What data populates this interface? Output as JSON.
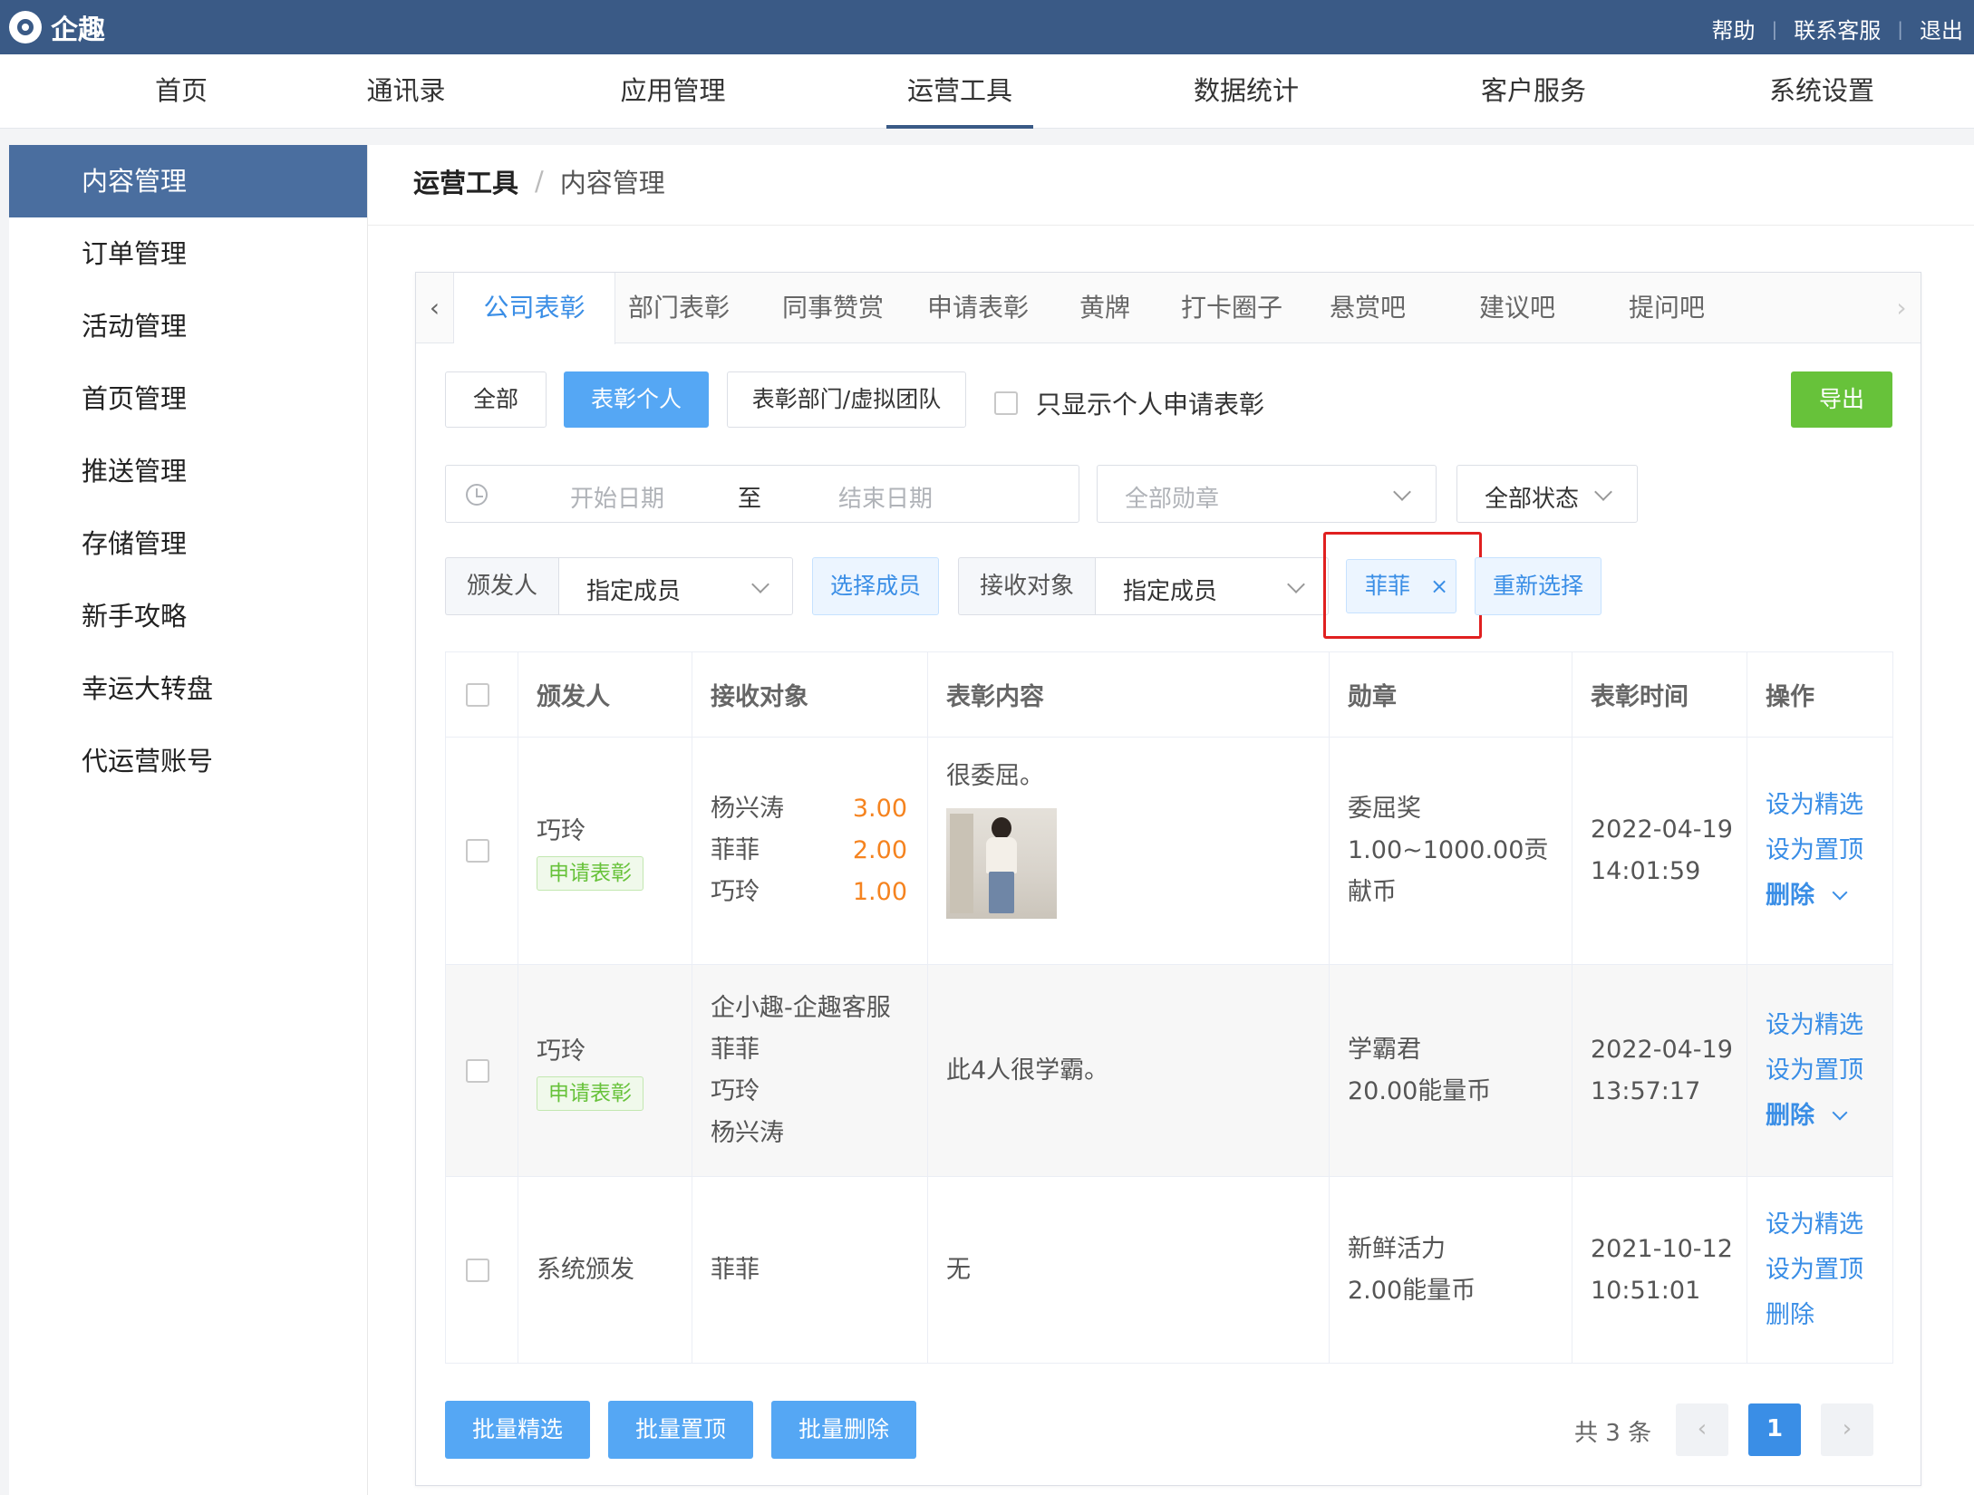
{
  "app": {
    "name": "企趣"
  },
  "top_links": [
    "帮助",
    "联系客服",
    "退出"
  ],
  "nav": [
    "首页",
    "通讯录",
    "应用管理",
    "运营工具",
    "数据统计",
    "客户服务",
    "系统设置"
  ],
  "nav_active": "运营工具",
  "sidebar": [
    "内容管理",
    "订单管理",
    "活动管理",
    "首页管理",
    "推送管理",
    "存储管理",
    "新手攻略",
    "幸运大转盘",
    "代运营账号"
  ],
  "sidebar_active": "内容管理",
  "breadcrumb": {
    "root": "运营工具",
    "separator": "/",
    "leaf": "内容管理"
  },
  "tabs": [
    "公司表彰",
    "部门表彰",
    "同事赞赏",
    "申请表彰",
    "黄牌",
    "打卡圈子",
    "悬赏吧",
    "建议吧",
    "提问吧"
  ],
  "tab_active": "公司表彰",
  "filter_buttons": {
    "all": "全部",
    "individual": "表彰个人",
    "dept": "表彰部门/虚拟团队",
    "only_personal": "只显示个人申请表彰",
    "export": "导出"
  },
  "date_range": {
    "start_placeholder": "开始日期",
    "to": "至",
    "end_placeholder": "结束日期"
  },
  "medal_select": {
    "placeholder": "全部勋章"
  },
  "status_select": {
    "value": "全部状态"
  },
  "issuer": {
    "label": "颁发人",
    "value": "指定成员",
    "select_btn": "选择成员"
  },
  "receiver": {
    "label": "接收对象",
    "value": "指定成员",
    "tag": "菲菲",
    "reselect_btn": "重新选择"
  },
  "table": {
    "headers": [
      "颁发人",
      "接收对象",
      "表彰内容",
      "勋章",
      "表彰时间",
      "操作"
    ],
    "rows": [
      {
        "issuer": "巧玲",
        "badge": "申请表彰",
        "receivers": [
          {
            "name": "杨兴涛",
            "amount": "3.00"
          },
          {
            "name": "菲菲",
            "amount": "2.00"
          },
          {
            "name": "巧玲",
            "amount": "1.00"
          }
        ],
        "content": "很委屈。",
        "has_image": true,
        "medal": [
          "委屈奖",
          "1.00~1000.00贡",
          "献币"
        ],
        "date": "2022-04-19",
        "time": "14:01:59",
        "ops": [
          "设为精选",
          "设为置顶",
          "删除"
        ]
      },
      {
        "issuer": "巧玲",
        "badge": "申请表彰",
        "receivers_plain": [
          "企小趣-企趣客服",
          "菲菲",
          "巧玲",
          "杨兴涛"
        ],
        "content": "此4人很学霸。",
        "has_image": false,
        "medal": [
          "学霸君",
          "20.00能量币"
        ],
        "date": "2022-04-19",
        "time": "13:57:17",
        "ops": [
          "设为精选",
          "设为置顶",
          "删除"
        ]
      },
      {
        "issuer": "系统颁发",
        "badge": "",
        "receivers_plain": [
          "菲菲"
        ],
        "content": "无",
        "has_image": false,
        "medal": [
          "新鲜活力",
          "2.00能量币"
        ],
        "date": "2021-10-12",
        "time": "10:51:01",
        "ops": [
          "设为精选",
          "设为置顶",
          "删除"
        ]
      }
    ]
  },
  "bulk": [
    "批量精选",
    "批量置顶",
    "批量删除"
  ],
  "pagination": {
    "total": "共 3 条",
    "prev": "‹",
    "current": "1",
    "next": "›"
  },
  "colors": {
    "topbar": "#3a5a86",
    "primary": "#55a7f4",
    "link": "#3a8ee6",
    "success": "#67c23a",
    "amount": "#f5831f",
    "highlight": "#e02020"
  }
}
